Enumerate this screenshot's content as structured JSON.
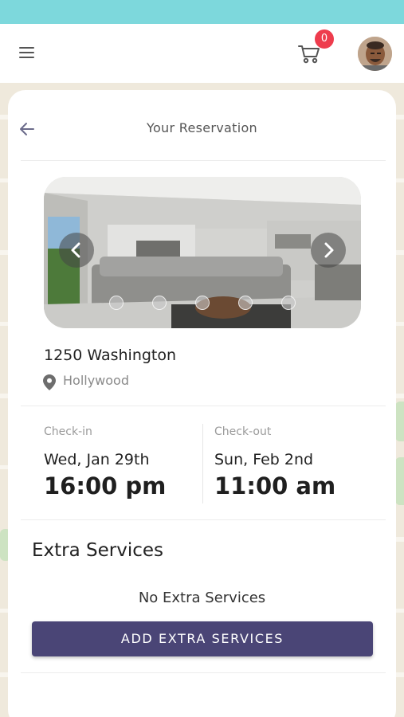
{
  "header": {
    "menu_icon": "hamburger-menu-icon",
    "cart_icon": "shopping-cart-icon",
    "cart_count": "0",
    "avatar": "user-avatar"
  },
  "page": {
    "title": "Your Reservation",
    "back_icon": "arrow-left-icon"
  },
  "property": {
    "name": "1250 Washington",
    "location": "Hollywood",
    "location_icon": "map-pin-icon",
    "carousel": {
      "prev_icon": "chevron-left-icon",
      "next_icon": "chevron-right-icon",
      "slide_count": 5
    }
  },
  "stay": {
    "check_in": {
      "label": "Check-in",
      "date": "Wed, Jan 29th",
      "time": "16:00 pm"
    },
    "check_out": {
      "label": "Check-out",
      "date": "Sun, Feb 2nd",
      "time": "11:00 am"
    }
  },
  "extras": {
    "title": "Extra Services",
    "empty_text": "No Extra Services",
    "add_button": "ADD EXTRA SERVICES"
  },
  "colors": {
    "status_bar": "#7dd8dc",
    "badge": "#ee3c4d",
    "primary_button": "#4a4576"
  }
}
